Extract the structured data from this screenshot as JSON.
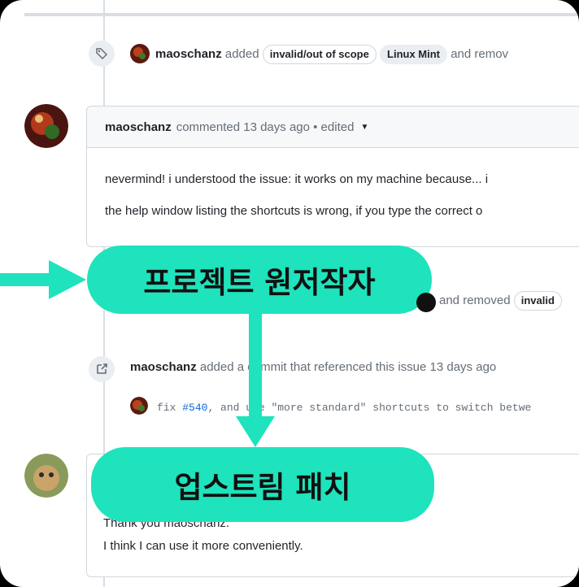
{
  "events": {
    "label_event": {
      "user": "maoschanz",
      "verb": "added",
      "labels": [
        "invalid/out of scope",
        "Linux Mint"
      ],
      "tail": "and remov"
    },
    "comment1": {
      "user": "maoschanz",
      "meta": "commented 13 days ago • edited",
      "lines": [
        "nevermind! i understood the issue: it works on my machine because... i",
        "the help window listing the shortcuts is wrong, if you type the correct o"
      ]
    },
    "label_event2": {
      "tail": "and removed",
      "label": "invalid"
    },
    "commit_event": {
      "user": "maoschanz",
      "text": "added a commit that referenced this issue 13 days ago",
      "commit_prefix": "fix",
      "commit_ref": "#540",
      "commit_rest": ", and use \"more standard\" shortcuts to switch betwe"
    },
    "comment2": {
      "lines": [
        "Thank you maoschanz.",
        "I think I can use it more conveniently."
      ]
    }
  },
  "callouts": {
    "original_author": "프로젝트 원저작자",
    "upstream_patch": "업스트림 패치"
  },
  "colors": {
    "callout": "#1ee3bd",
    "link": "#0969da"
  }
}
